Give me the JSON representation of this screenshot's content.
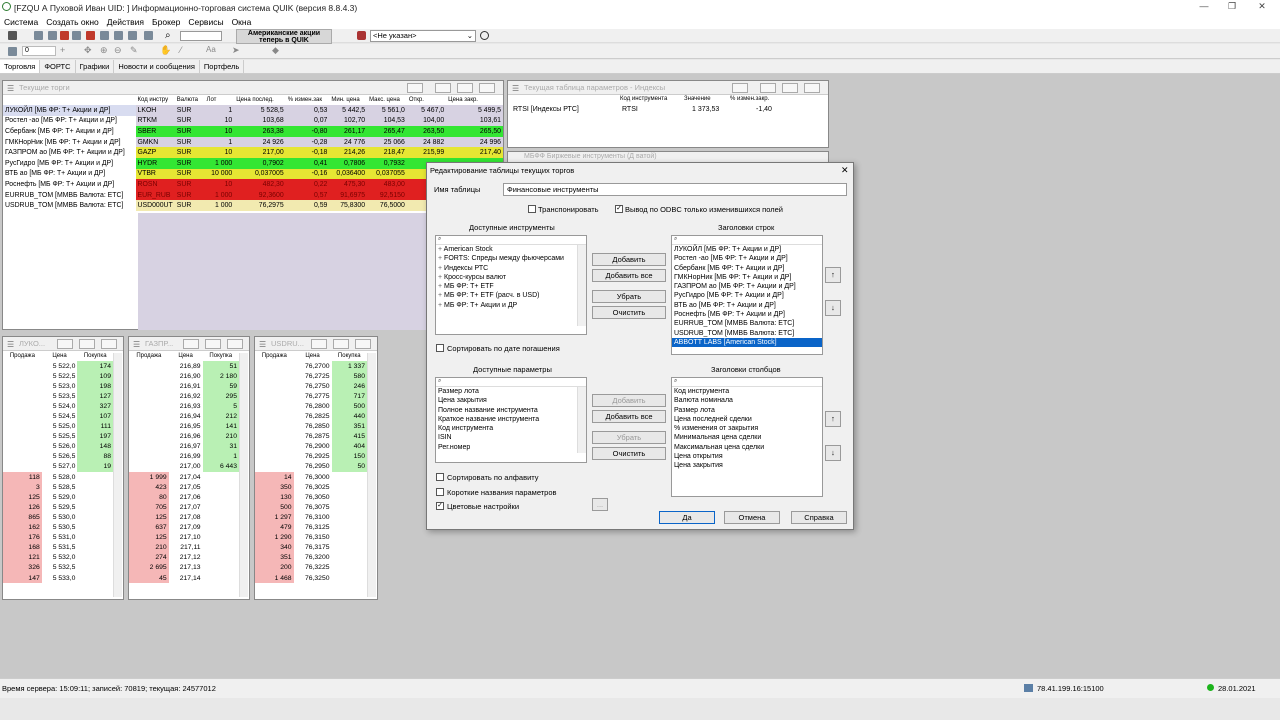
{
  "app_title": "[FZQU          А Пуховой Иван UID:           ] Информационно-торговая система QUIK (версия 8.8.4.3)",
  "menu": [
    "Система",
    "Создать окно",
    "Действия",
    "Брокер",
    "Сервисы",
    "Окна"
  ],
  "toolbar": {
    "ad_line1": "Американские акции",
    "ad_line2": "теперь в QUIK",
    "security_select": "<Не указан>",
    "zoom_value": "0"
  },
  "tabs": [
    "Торговля",
    "ФОРТС",
    "Графики",
    "Новости и сообщения",
    "Портфель"
  ],
  "current_trades": {
    "title": "Текущие торги",
    "headers": [
      "",
      "Код инстру",
      "Валюта",
      "Лот",
      "Цена послед.",
      "% измен.зак",
      "Мин. цена",
      "Макс. цена",
      "Откр.",
      "Цена закр."
    ],
    "rows": [
      [
        "ЛУКОЙЛ [МБ ФР: Т+ Акции и ДР]",
        "LKOH",
        "SUR",
        "1",
        "5 528,5",
        "0,53",
        "5 442,5",
        "5 561,0",
        "5 467,0",
        "5 499,5"
      ],
      [
        "Ростел -ао [МБ ФР: Т+ Акции и ДР]",
        "RTKM",
        "SUR",
        "10",
        "103,68",
        "0,07",
        "102,70",
        "104,53",
        "104,00",
        "103,61"
      ],
      [
        "Сбербанк [МБ ФР: Т+ Акции и ДР]",
        "SBER",
        "SUR",
        "10",
        "263,38",
        "-0,80",
        "261,17",
        "265,47",
        "263,50",
        "265,50"
      ],
      [
        "ГМКНорНик [МБ ФР: Т+ Акции и ДР]",
        "GMKN",
        "SUR",
        "1",
        "24 926",
        "-0,28",
        "24 776",
        "25 066",
        "24 882",
        "24 996"
      ],
      [
        "ГАЗПРОМ ао [МБ ФР: Т+ Акции и ДР]",
        "GAZP",
        "SUR",
        "10",
        "217,00",
        "-0,18",
        "214,26",
        "218,47",
        "215,99",
        "217,40"
      ],
      [
        "РусГидро [МБ ФР: Т+ Акции и ДР]",
        "HYDR",
        "SUR",
        "1 000",
        "0,7902",
        "0,41",
        "0,7806",
        "0,7932",
        "",
        ""
      ],
      [
        "ВТБ ао [МБ ФР: Т+ Акции и ДР]",
        "VTBR",
        "SUR",
        "10 000",
        "0,037005",
        "-0,16",
        "0,036400",
        "0,037055",
        "",
        ""
      ],
      [
        "Роснефть [МБ ФР: Т+ Акции и ДР]",
        "ROSN",
        "SUR",
        "10",
        "482,30",
        "0,22",
        "475,30",
        "483,00",
        "",
        ""
      ],
      [
        "EURRUB_TOM [ММВБ Валюта: ETC]",
        "EUR_RUB",
        "SUR",
        "1 000",
        "92,3600",
        "0,57",
        "91,6975",
        "92,5150",
        "",
        ""
      ],
      [
        "USDRUB_TOM [ММВБ Валюта: ETC]",
        "USD000UT",
        "SUR",
        "1 000",
        "76,2975",
        "0,59",
        "75,8300",
        "76,5000",
        "",
        ""
      ]
    ],
    "row_colors": [
      "",
      "",
      "g",
      "",
      "y",
      "g",
      "y",
      "rd",
      "rd",
      "ly"
    ]
  },
  "indices": {
    "title": "Текущая таблица параметров - Индексы",
    "headers": [
      "",
      "Код инструмента",
      "Значение",
      "% измен.закр."
    ],
    "row": [
      "RTSI [Индексы РТС]",
      "RTSI",
      "1 373,53",
      "-1,40"
    ],
    "behind_title": "МБФФ Биржевые инструменты (Д ватой)"
  },
  "orderbooks": [
    {
      "title": "ЛУКО...",
      "rows": [
        [
          "",
          "5 522,0",
          "174"
        ],
        [
          "",
          "5 522,5",
          "109"
        ],
        [
          "",
          "5 523,0",
          "198"
        ],
        [
          "",
          "5 523,5",
          "127"
        ],
        [
          "",
          "5 524,0",
          "327"
        ],
        [
          "",
          "5 524,5",
          "107"
        ],
        [
          "",
          "5 525,0",
          "111"
        ],
        [
          "",
          "5 525,5",
          "197"
        ],
        [
          "",
          "5 526,0",
          "148"
        ],
        [
          "",
          "5 526,5",
          "88"
        ],
        [
          "",
          "5 527,0",
          "19"
        ],
        [
          "118",
          "5 528,0",
          ""
        ],
        [
          "3",
          "5 528,5",
          ""
        ],
        [
          "125",
          "5 529,0",
          ""
        ],
        [
          "126",
          "5 529,5",
          ""
        ],
        [
          "865",
          "5 530,0",
          ""
        ],
        [
          "162",
          "5 530,5",
          ""
        ],
        [
          "176",
          "5 531,0",
          ""
        ],
        [
          "168",
          "5 531,5",
          ""
        ],
        [
          "121",
          "5 532,0",
          ""
        ],
        [
          "326",
          "5 532,5",
          ""
        ],
        [
          "147",
          "5 533,0",
          ""
        ]
      ]
    },
    {
      "title": "ГАЗПР...",
      "rows": [
        [
          "",
          "216,89",
          "51"
        ],
        [
          "",
          "216,90",
          "2 180"
        ],
        [
          "",
          "216,91",
          "59"
        ],
        [
          "",
          "216,92",
          "295"
        ],
        [
          "",
          "216,93",
          "5"
        ],
        [
          "",
          "216,94",
          "212"
        ],
        [
          "",
          "216,95",
          "141"
        ],
        [
          "",
          "216,96",
          "210"
        ],
        [
          "",
          "216,97",
          "31"
        ],
        [
          "",
          "216,99",
          "1"
        ],
        [
          "",
          "217,00",
          "6 443"
        ],
        [
          "1 999",
          "217,04",
          ""
        ],
        [
          "423",
          "217,05",
          ""
        ],
        [
          "80",
          "217,06",
          ""
        ],
        [
          "705",
          "217,07",
          ""
        ],
        [
          "125",
          "217,08",
          ""
        ],
        [
          "637",
          "217,09",
          ""
        ],
        [
          "125",
          "217,10",
          ""
        ],
        [
          "210",
          "217,11",
          ""
        ],
        [
          "274",
          "217,12",
          ""
        ],
        [
          "2 695",
          "217,13",
          ""
        ],
        [
          "45",
          "217,14",
          ""
        ]
      ]
    },
    {
      "title": "USDRU...",
      "rows": [
        [
          "",
          "76,2700",
          "1 337"
        ],
        [
          "",
          "76,2725",
          "580"
        ],
        [
          "",
          "76,2750",
          "246"
        ],
        [
          "",
          "76,2775",
          "717"
        ],
        [
          "",
          "76,2800",
          "500"
        ],
        [
          "",
          "76,2825",
          "440"
        ],
        [
          "",
          "76,2850",
          "351"
        ],
        [
          "",
          "76,2875",
          "415"
        ],
        [
          "",
          "76,2900",
          "404"
        ],
        [
          "",
          "76,2925",
          "150"
        ],
        [
          "",
          "76,2950",
          "50"
        ],
        [
          "14",
          "76,3000",
          ""
        ],
        [
          "350",
          "76,3025",
          ""
        ],
        [
          "130",
          "76,3050",
          ""
        ],
        [
          "500",
          "76,3075",
          ""
        ],
        [
          "1 297",
          "76,3100",
          ""
        ],
        [
          "479",
          "76,3125",
          ""
        ],
        [
          "1 290",
          "76,3150",
          ""
        ],
        [
          "340",
          "76,3175",
          ""
        ],
        [
          "351",
          "76,3200",
          ""
        ],
        [
          "200",
          "76,3225",
          ""
        ],
        [
          "1 468",
          "76,3250",
          ""
        ]
      ]
    }
  ],
  "orderbook_headers": [
    "Продажа",
    "Цена",
    "Покупка"
  ],
  "dialog": {
    "title": "Редактирование таблицы текущих торгов",
    "table_name_label": "Имя таблицы",
    "table_name_value": "Финансовые инструменты",
    "transpose_label": "Транспонировать",
    "odbc_label": "Вывод по ODBC только изменившихся  полей",
    "avail_instr_label": "Доступные инструменты",
    "avail_instr": [
      "American Stock",
      "FORTS: Спреды между фьючерсами",
      "Индексы РТС",
      "Кросс-курсы валют",
      "МБ ФР: Т+ ETF",
      "МБ ФР: Т+ ETF (расч. в USD)",
      "МБ ФР: Т+ Акции и ДР"
    ],
    "row_headers_label": "Заголовки строк",
    "row_headers": [
      "ЛУКОЙЛ [МБ ФР: Т+ Акции и ДР]",
      "Ростел -ао [МБ ФР: Т+ Акции и ДР]",
      "Сбербанк [МБ ФР: Т+ Акции и ДР]",
      "ГМКНорНик [МБ ФР: Т+ Акции и ДР]",
      "ГАЗПРОМ ао [МБ ФР: Т+ Акции и ДР]",
      "РусГидро [МБ ФР: Т+ Акции и ДР]",
      "ВТБ ао [МБ ФР: Т+ Акции и ДР]",
      "Роснефть [МБ ФР: Т+ Акции и ДР]",
      "EURRUB_TOM [ММВБ Валюта: ETC]",
      "USDRUB_TOM [ММВБ Валюта: ETC]",
      "ABBOTT LABS [American Stock]"
    ],
    "btn_add": "Добавить",
    "btn_add_all": "Добавить все",
    "btn_remove": "Убрать",
    "btn_clear": "Очистить",
    "sort_date_label": "Сортировать по дате погашения",
    "avail_params_label": "Доступные параметры",
    "avail_params": [
      "Размер лота",
      "Цена закрытия",
      "Полное название инструмента",
      "Краткое название инструмента",
      "Код инструмента",
      "ISIN",
      "Рег.номер"
    ],
    "col_headers_label": "Заголовки столбцов",
    "col_headers": [
      "Код инструмента",
      "Валюта номинала",
      "Размер лота",
      "Цена последней сделки",
      "% изменения от закрытия",
      "Минимальная цена сделки",
      "Максимальная цена сделки",
      "Цена открытия",
      "Цена закрытия"
    ],
    "sort_alpha_label": "Сортировать по алфавиту",
    "short_names_label": "Короткие названия параметров",
    "color_settings_label": "Цветовые настройки",
    "btn_ok": "Да",
    "btn_cancel": "Отмена",
    "btn_help": "Справка",
    "btn_more": "..."
  },
  "status": {
    "left": "Время сервера: 15:09:11; записей: 70819; текущая: 24577012",
    "ip": "78.41.199.16:15100",
    "date": "28.01.2021"
  }
}
